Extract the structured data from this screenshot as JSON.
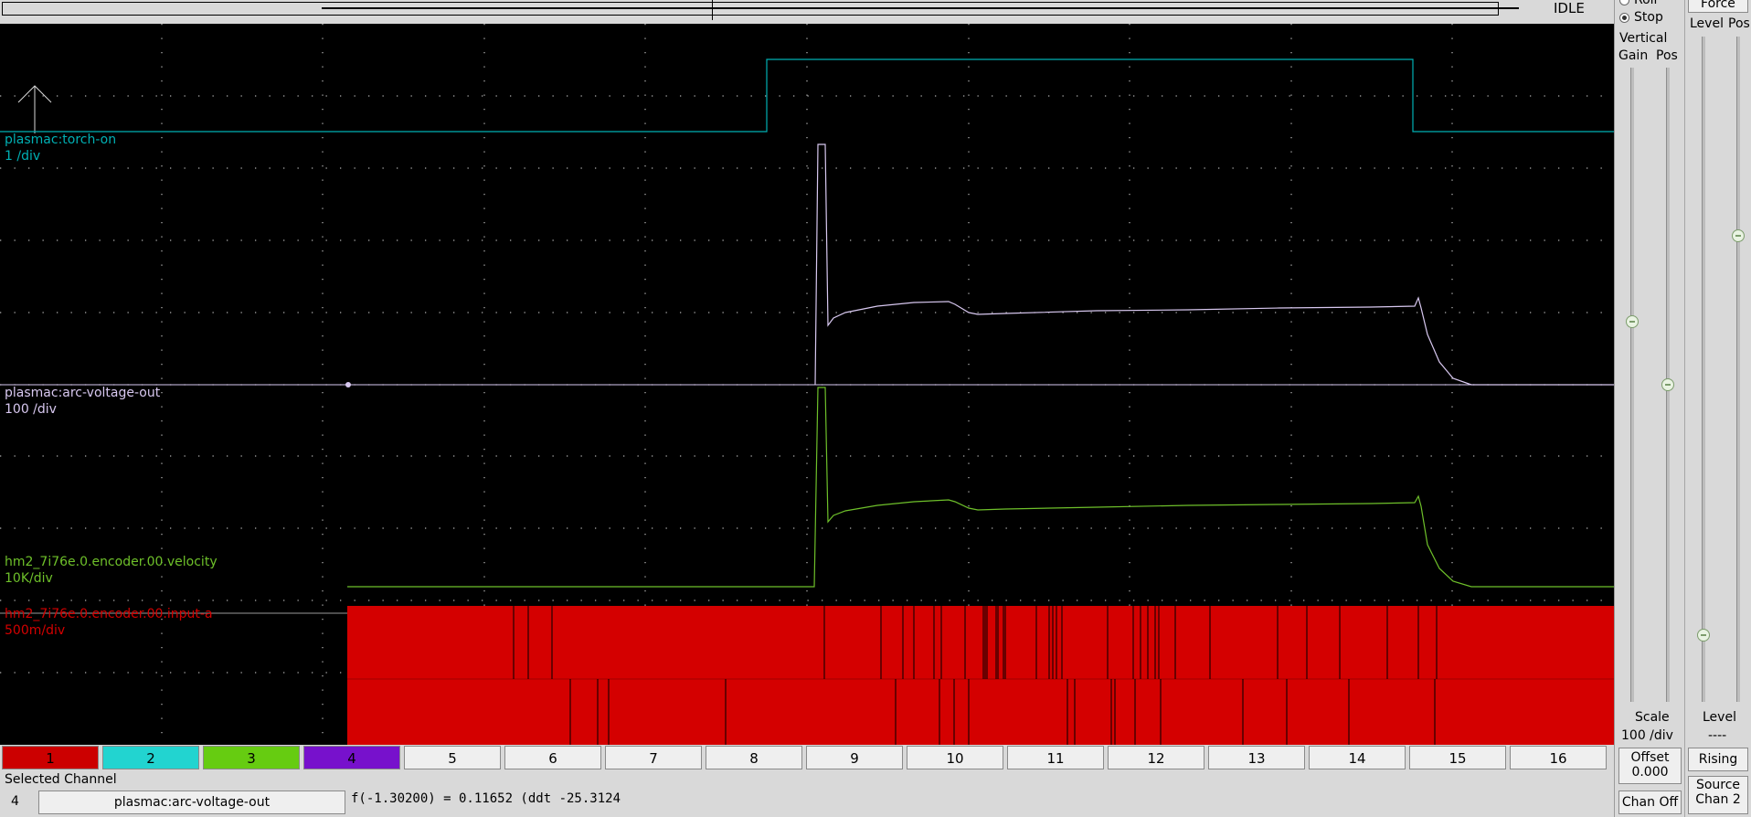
{
  "status": {
    "state": "IDLE"
  },
  "traces": [
    {
      "name": "plasmac:torch-on",
      "scale": "1 /div",
      "color": "#00b0b4"
    },
    {
      "name": "plasmac:arc-voltage-out",
      "scale": "100 /div",
      "color": "#d8c8f0"
    },
    {
      "name": "hm2_7i76e.0.encoder.00.velocity",
      "scale": "10K/div",
      "color": "#6ec02a"
    },
    {
      "name": "hm2_7i76e.0.encoder.00.input-a",
      "scale": "500m/div",
      "color": "#d40000"
    }
  ],
  "channels": [
    {
      "label": "1",
      "color": "#cc0000"
    },
    {
      "label": "2",
      "color": "#22d4d0"
    },
    {
      "label": "3",
      "color": "#66cc11"
    },
    {
      "label": "4",
      "color": "#7711cc"
    },
    {
      "label": "5"
    },
    {
      "label": "6"
    },
    {
      "label": "7"
    },
    {
      "label": "8"
    },
    {
      "label": "9"
    },
    {
      "label": "10"
    },
    {
      "label": "11"
    },
    {
      "label": "12"
    },
    {
      "label": "13"
    },
    {
      "label": "14"
    },
    {
      "label": "15"
    },
    {
      "label": "16"
    }
  ],
  "selected": {
    "section_label": "Selected Channel",
    "number": "4",
    "name": "plasmac:arc-voltage-out",
    "readout": "f(-1.30200) =  0.11652 (ddt -25.3124"
  },
  "run_mode": {
    "roll_label": "Roll",
    "stop_label": "Stop",
    "selected": "Stop"
  },
  "vertical": {
    "title": "Vertical",
    "gain_label": "Gain",
    "pos_label": "Pos",
    "gain_level": 0.6,
    "pos_level": 0.5,
    "scale_label": "Scale",
    "scale_value": "100 /div",
    "offset_label": "Offset",
    "offset_value": "0.000",
    "chan_off_label": "Chan Off"
  },
  "trigger": {
    "force_label": "Force",
    "level_label": "Level",
    "pos_label": "Pos",
    "level_level": 0.1,
    "pos_level": 0.7,
    "level_title": "Level",
    "level_value": "----",
    "edge_label": "Rising",
    "source_label": "Source",
    "source_value": "Chan 2"
  }
}
